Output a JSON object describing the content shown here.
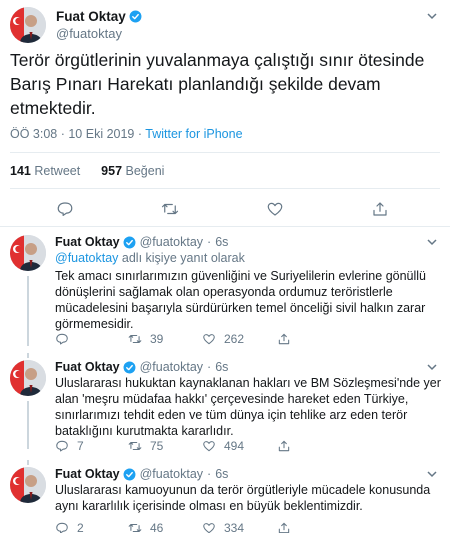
{
  "main_tweet": {
    "name": "Fuat Oktay",
    "handle": "@fuatoktay",
    "text": "Terör örgütlerinin yuvalanmaya çalıştığı sınır ötesinde Barış Pınarı Harekatı planlandığı şekilde devam etmektedir.",
    "time": "ÖÖ 3:08 · 10 Eki 2019 · ",
    "source": "Twitter for iPhone",
    "retweets_count": "141",
    "retweets_label": "Retweet",
    "likes_count": "957",
    "likes_label": "Beğeni"
  },
  "replies": [
    {
      "name": "Fuat Oktay",
      "handle": "@fuatoktay",
      "time": "6s",
      "replying_mention": "@fuatoktay",
      "replying_suffix": " adlı kişiye yanıt olarak",
      "text": "Tek amacı sınırlarımızın güvenliğini ve Suriyelilerin evlerine gönüllü dönüşlerini sağlamak olan operasyonda ordumuz teröristlerle mücadelesini başarıyla sürdürürken temel önceliği sivil halkın zarar görmemesidir.",
      "replies_count": "",
      "retweets_count": "39",
      "likes_count": "262"
    },
    {
      "name": "Fuat Oktay",
      "handle": "@fuatoktay",
      "time": "6s",
      "text": "Uluslararası hukuktan kaynaklanan hakları ve BM Sözleşmesi'nde yer alan 'meşru müdafaa hakkı' çerçevesinde hareket eden Türkiye, sınırlarımızı tehdit eden ve tüm dünya için tehlike arz eden terör bataklığını kurutmakta kararlıdır.",
      "replies_count": "7",
      "retweets_count": "75",
      "likes_count": "494"
    },
    {
      "name": "Fuat Oktay",
      "handle": "@fuatoktay",
      "time": "6s",
      "text": "Uluslararası kamuoyunun da terör örgütleriyle mücadele konusunda aynı kararlılık içerisinde olması en büyük beklentimizdir.",
      "replies_count": "2",
      "retweets_count": "46",
      "likes_count": "334"
    }
  ],
  "colors": {
    "accent": "#1da1f2",
    "link": "#1b95e0",
    "muted": "#657786",
    "text": "#14171a",
    "divider": "#e6ecf0"
  },
  "icons": [
    "verified-badge-icon",
    "chevron-down-icon",
    "reply-icon",
    "retweet-icon",
    "like-icon",
    "share-icon"
  ]
}
